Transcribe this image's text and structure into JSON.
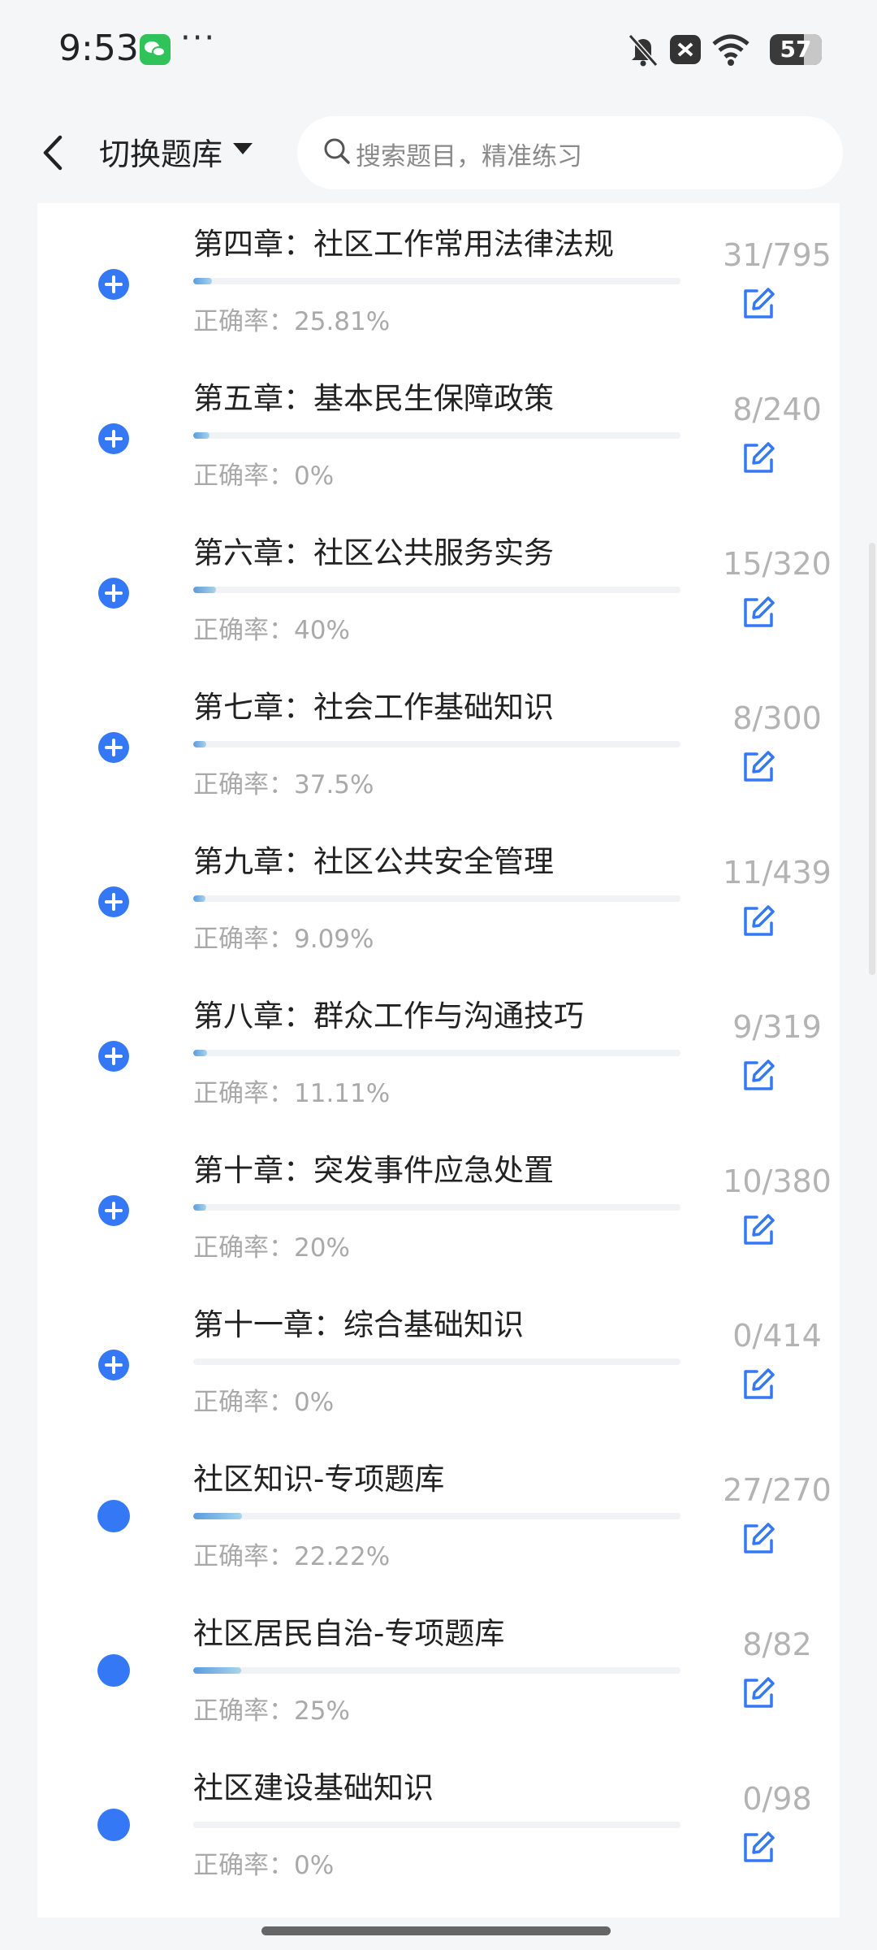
{
  "status_bar": {
    "time": "9:53",
    "extra_dots": "···",
    "battery": "57",
    "icons": [
      "bell-off-icon",
      "close-notification-icon",
      "wifi-icon",
      "battery-icon",
      "wechat-icon"
    ]
  },
  "header": {
    "switch_label": "切换题库",
    "search_placeholder": "搜索题目，精准练习"
  },
  "colors": {
    "accent": "#3478f6",
    "muted_text": "#a9a9a9",
    "progress_fill": "#7ab6e6"
  },
  "rate_prefix": "正确率：",
  "chapters": [
    {
      "title": "第四章：社区工作常用法律法规",
      "count": "31/795",
      "rate": "正确率：25.81%",
      "progress": 0.039,
      "marker": "plus"
    },
    {
      "title": "第五章：基本民生保障政策",
      "count": "8/240",
      "rate": "正确率：0%",
      "progress": 0.033,
      "marker": "plus"
    },
    {
      "title": "第六章：社区公共服务实务",
      "count": "15/320",
      "rate": "正确率：40%",
      "progress": 0.047,
      "marker": "plus"
    },
    {
      "title": "第七章：社会工作基础知识",
      "count": "8/300",
      "rate": "正确率：37.5%",
      "progress": 0.027,
      "marker": "plus"
    },
    {
      "title": "第九章：社区公共安全管理",
      "count": "11/439",
      "rate": "正确率：9.09%",
      "progress": 0.025,
      "marker": "plus"
    },
    {
      "title": "第八章：群众工作与沟通技巧",
      "count": "9/319",
      "rate": "正确率：11.11%",
      "progress": 0.028,
      "marker": "plus"
    },
    {
      "title": "第十章：突发事件应急处置",
      "count": "10/380",
      "rate": "正确率：20%",
      "progress": 0.026,
      "marker": "plus"
    },
    {
      "title": "第十一章：综合基础知识",
      "count": "0/414",
      "rate": "正确率：0%",
      "progress": 0.0,
      "marker": "plus"
    },
    {
      "title": "社区知识-专项题库",
      "count": "27/270",
      "rate": "正确率：22.22%",
      "progress": 0.1,
      "marker": "dot"
    },
    {
      "title": "社区居民自治-专项题库",
      "count": "8/82",
      "rate": "正确率：25%",
      "progress": 0.098,
      "marker": "dot"
    },
    {
      "title": "社区建设基础知识",
      "count": "0/98",
      "rate": "正确率：0%",
      "progress": 0.0,
      "marker": "dot"
    }
  ]
}
